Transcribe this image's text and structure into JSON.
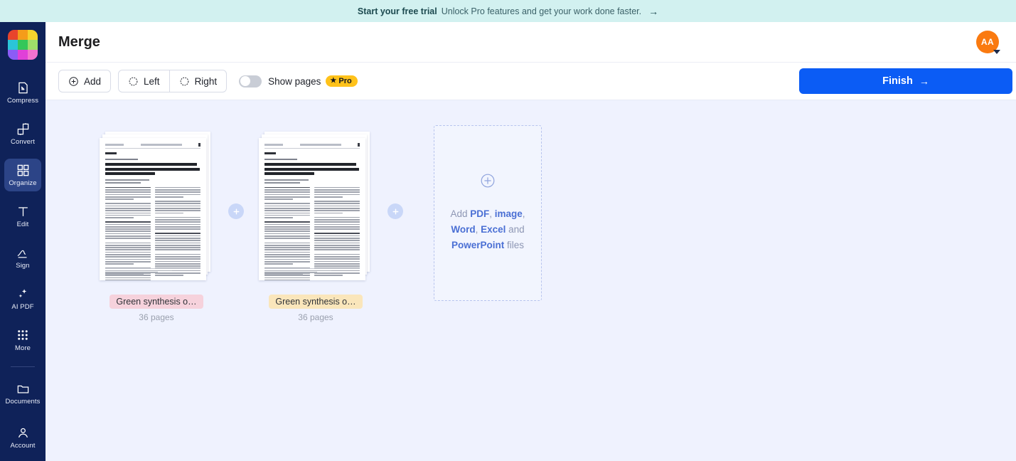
{
  "banner": {
    "strong": "Start your free trial",
    "text": "Unlock Pro features and get your work done faster.",
    "arrow": "→"
  },
  "sidebar": {
    "logo_name": "app-logo",
    "logo_colors": [
      "#e8442c",
      "#f59c1a",
      "#f6d32d",
      "#2bc5d8",
      "#34c759",
      "#9ede6a",
      "#8b5cf6",
      "#e040d8",
      "#f472d0"
    ],
    "items": [
      {
        "label": "Compress",
        "icon": "compress-icon",
        "active": false
      },
      {
        "label": "Convert",
        "icon": "convert-icon",
        "active": false
      },
      {
        "label": "Organize",
        "icon": "organize-icon",
        "active": true
      },
      {
        "label": "Edit",
        "icon": "edit-icon",
        "active": false
      },
      {
        "label": "Sign",
        "icon": "sign-icon",
        "active": false
      },
      {
        "label": "AI PDF",
        "icon": "ai-pdf-icon",
        "active": false
      },
      {
        "label": "More",
        "icon": "more-grid-icon",
        "active": false
      },
      {
        "label": "Documents",
        "icon": "folder-icon",
        "active": false
      }
    ],
    "account": {
      "label": "Account",
      "icon": "user-icon"
    }
  },
  "header": {
    "title": "Merge",
    "avatar_initials": "AA",
    "avatar_color": "#fa7a10"
  },
  "toolbar": {
    "add_label": "Add",
    "left_label": "Left",
    "right_label": "Right",
    "show_pages_label": "Show pages",
    "show_pages_on": false,
    "pro_badge": "Pro",
    "pro_star": "★",
    "finish_label": "Finish",
    "finish_arrow": "→",
    "finish_color": "#0b5cf5"
  },
  "files": [
    {
      "name": "Green synthesis o…",
      "pages": "36 pages",
      "label_color": "#f6d2dc",
      "doc_title": "Green synthesis of metal and metal oxide nanoparticles from plant leaf extracts and their applications: A review"
    },
    {
      "name": "Green synthesis o…",
      "pages": "36 pages",
      "label_color": "#fae6bb",
      "doc_title": "Green synthesis of metal and metal oxide nanoparticles from plant leaf extracts and their applications: A review"
    }
  ],
  "dropzone": {
    "plus_icon": "plus-circle-icon",
    "line1_pre": "Add ",
    "t_pdf": "PDF",
    "t_image": "image",
    "t_word": "Word",
    "t_excel": "Excel",
    "t_powerpoint": "PowerPoint",
    "tail": "files",
    "and": " and ",
    "comma": ", "
  }
}
